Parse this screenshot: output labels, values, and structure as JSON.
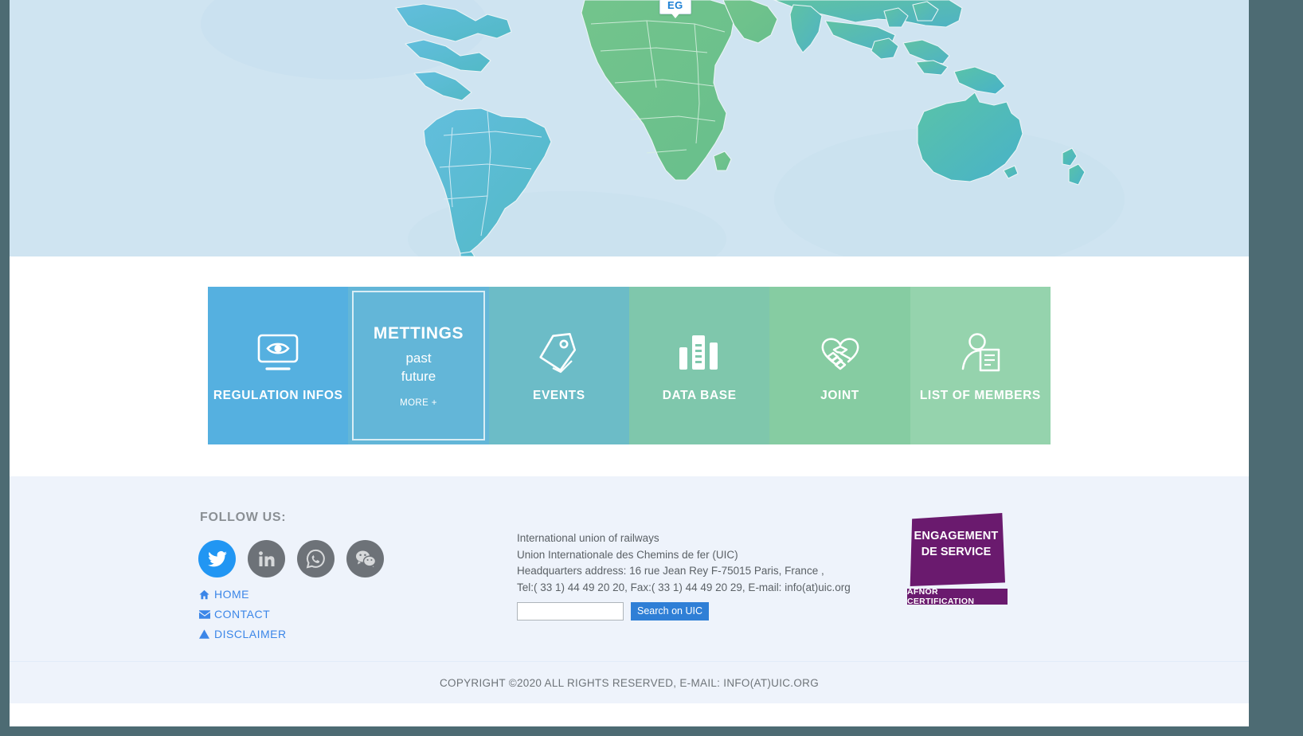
{
  "map": {
    "tooltip_label": "EG",
    "ocean_color": "#cfe4f1",
    "africa_color": "#6fc08a",
    "asia_color": "#5fc0b4",
    "americas_color": "#5ab5d6",
    "oceania_color": "#4fb8b2"
  },
  "tiles": [
    {
      "label": "REGULATION INFOS",
      "icon": "eye-monitor-icon",
      "color": "#55b0e0"
    },
    {
      "label": "METTINGS",
      "icon": "none",
      "color": "#63b6d8",
      "sub1": "past",
      "sub2": "future",
      "more": "MORE +"
    },
    {
      "label": "EVENTS",
      "icon": "tag-icon",
      "color": "#6cbcc7"
    },
    {
      "label": "DATA BASE",
      "icon": "bar-chart-icon",
      "color": "#7fc7ac"
    },
    {
      "label": "JOINT",
      "icon": "handshake-heart-icon",
      "color": "#86cca2"
    },
    {
      "label": "LIST OF MEMBERS",
      "icon": "person-document-icon",
      "color": "#95d3ad"
    }
  ],
  "footer": {
    "follow_label": "FOLLOW US:",
    "socials": [
      {
        "name": "twitter",
        "color": "#2196f3"
      },
      {
        "name": "linkedin",
        "color": "#6d7278"
      },
      {
        "name": "whatsapp",
        "color": "#6d7278"
      },
      {
        "name": "wechat",
        "color": "#6d7278"
      }
    ],
    "links": [
      {
        "label": "HOME",
        "icon": "home-icon"
      },
      {
        "label": "CONTACT",
        "icon": "envelope-icon"
      },
      {
        "label": "DISCLAIMER",
        "icon": "warning-triangle-icon"
      }
    ],
    "address": [
      "International union of railways",
      "Union Internationale des Chemins de fer (UIC)",
      "Headquarters address: 16 rue Jean Rey F-75015 Paris, France ,",
      "Tel:( 33 1) 44 49 20 20, Fax:( 33 1) 44 49 20 29, E-mail: info(at)uic.org"
    ],
    "search": {
      "value": "",
      "placeholder": "",
      "button_label": "Search on UIC"
    },
    "certification": {
      "line1": "ENGAGEMENT",
      "line2": "DE SERVICE",
      "bar": "AFNOR CERTIFICATION",
      "color": "#6a1a6e"
    }
  },
  "copyright": {
    "text": "COPYRIGHT ©2020  ALL RIGHTS RESERVED, E-MAIL: INFO(AT)UIC.ORG"
  }
}
